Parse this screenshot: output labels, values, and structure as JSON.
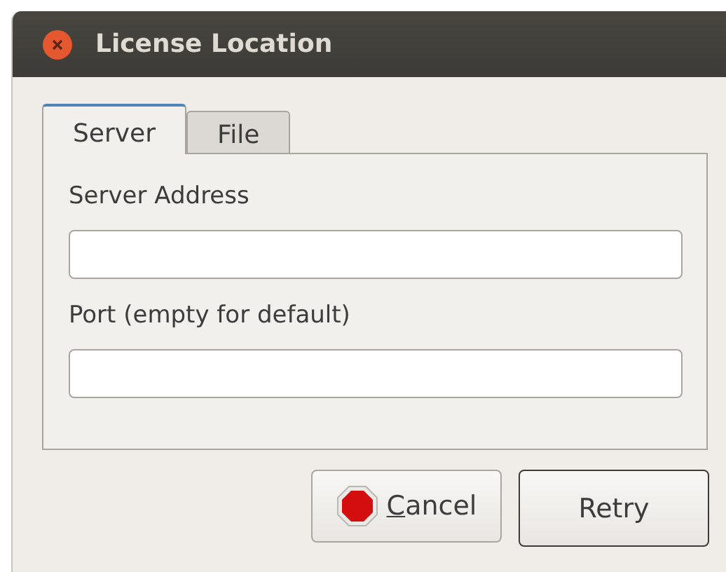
{
  "window": {
    "title": "License Location"
  },
  "tabs": [
    {
      "label": "Server",
      "selected": true
    },
    {
      "label": "File",
      "selected": false
    }
  ],
  "fields": [
    {
      "label": "Server Address"
    },
    {
      "label": "Port (empty for default)"
    }
  ],
  "buttons": [
    {
      "label": "Cancel",
      "kind": "stop",
      "mnemonic_first": true,
      "default": false
    },
    {
      "label": "Retry",
      "kind": "plain",
      "mnemonic_first": false,
      "default": true
    }
  ]
}
